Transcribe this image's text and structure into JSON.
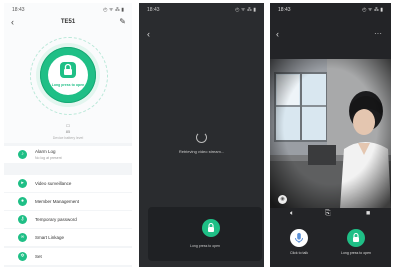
{
  "screen1": {
    "time": "18:43",
    "status_indicators": "◴ ᯤ ⁂ ▮",
    "nav": {
      "title": "TE51"
    },
    "hero": {
      "press_text": "Long press to open",
      "battery_value": "85",
      "subtext": "Device battery level"
    },
    "items": [
      {
        "label": "Alarm Log",
        "sub": "No log at present",
        "icon": "bell-icon"
      },
      {
        "label": "Video surveillance",
        "icon": "camera-icon"
      },
      {
        "label": "Member Management",
        "icon": "person-icon"
      },
      {
        "label": "Temporary password",
        "icon": "key-icon"
      },
      {
        "label": "Smart Linkage",
        "icon": "link-icon"
      },
      {
        "label": "Set",
        "icon": "gear-icon"
      }
    ]
  },
  "screen2": {
    "time": "18:43",
    "status_indicators": "◴ ᯤ ⁂ ▮",
    "loading_text": "Retrieving video stream...",
    "unlock_label": "Long press to open"
  },
  "screen3": {
    "time": "18:43",
    "status_indicators": "◴ ᯤ ⁂ ▮",
    "talk_label": "Click to talk",
    "unlock_label": "Long press to open"
  },
  "colors": {
    "accent": "#1fbf86",
    "dark_bg": "#2a2c2f"
  }
}
